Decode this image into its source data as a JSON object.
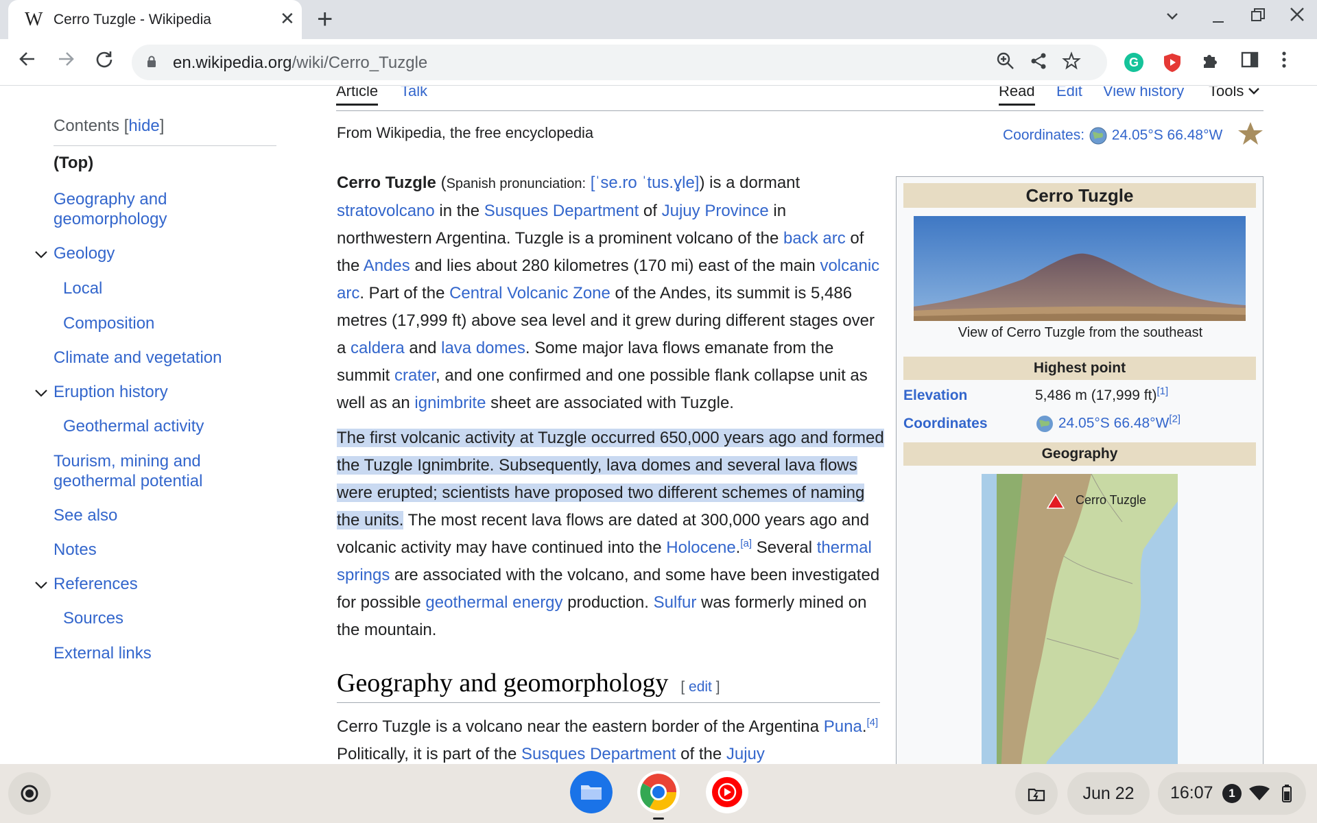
{
  "browser": {
    "tab_title": "Cerro Tuzgle - Wikipedia",
    "favicon": "W",
    "url_host": "en.wikipedia.org",
    "url_path": "/wiki/Cerro_Tuzgle"
  },
  "wiki": {
    "tabs": {
      "article": "Article",
      "talk": "Talk",
      "read": "Read",
      "edit": "Edit",
      "history": "View history",
      "tools": "Tools"
    },
    "from": "From Wikipedia, the free encyclopedia",
    "coords_label": "Coordinates:",
    "coords_value": "24.05°S 66.48°W"
  },
  "toc": {
    "heading": "Contents",
    "hide": "hide",
    "items": [
      "(Top)",
      "Geography and",
      "geomorphology",
      "Geology",
      "Local",
      "Composition",
      "Climate and vegetation",
      "Eruption history",
      "Geothermal activity",
      "Tourism, mining and",
      "geothermal potential",
      "See also",
      "Notes",
      "References",
      "Sources",
      "External links"
    ]
  },
  "article": {
    "title_bold": "Cerro Tuzgle",
    "p1": {
      "spanish": "Spanish pronunciation:",
      "ipa": "[ˈse.ro ˈtus.ɣle]",
      "t1": ") is a dormant",
      "l_strato": "stratovolcano",
      "t2": " in the ",
      "l_susques": "Susques Department",
      "t3": " of ",
      "l_jujuy": "Jujuy Province",
      "t4": " in northwestern Argentina. Tuzgle is a prominent volcano of the ",
      "l_backarc": "back arc",
      "t5": " of the ",
      "l_andes": "Andes",
      "t6": " and lies about 280 kilometres (170 mi) east of the main ",
      "l_volcarc": "volcanic arc",
      "t7": ". Part of the ",
      "l_cvz": "Central Volcanic Zone",
      "t8": " of the Andes, its summit is 5,486 metres (17,999 ft) above sea level and it grew during different stages over a ",
      "l_caldera": "caldera",
      "t9": " and ",
      "l_domes": "lava domes",
      "t10": ". Some major lava flows emanate from the summit ",
      "l_crater": "crater",
      "t11": ", and one confirmed and one possible flank collapse unit as well as an ",
      "l_ign": "ignimbrite",
      "t12": " sheet are associated with Tuzgle."
    },
    "p2": {
      "highlighted": "The first volcanic activity at Tuzgle occurred 650,000 years ago and formed the Tuzgle Ignimbrite. Subsequently, lava domes and several lava flows were erupted; scientists have proposed two different schemes of naming the units.",
      "t1": " The most recent lava flows are dated at 300,000 years ago and volcanic activity may have continued into the ",
      "l_holocene": "Holocene",
      "t2": ".",
      "note_a": "[a]",
      "t3": " Several ",
      "l_thermal": "thermal springs",
      "t4": " are associated with the volcano, and some have been investigated for possible ",
      "l_geo": "geothermal energy",
      "t5": " production. ",
      "l_sulfur": "Sulfur",
      "t6": " was formerly mined on the mountain."
    },
    "h2": "Geography and geomorphology",
    "h2_edit": "edit",
    "p3": {
      "t1": "Cerro Tuzgle is a volcano near the eastern border of the Argentina ",
      "l_puna": "Puna",
      "t2": ".",
      "ref4": "[4]",
      "t3": " Politically, it is part of the ",
      "l_susques": "Susques Department",
      "t4": " of the ",
      "l_jujuy": "Jujuy"
    }
  },
  "infobox": {
    "title": "Cerro Tuzgle",
    "caption": "View of Cerro Tuzgle from the southeast",
    "highest_point": "Highest point",
    "elevation_label": "Elevation",
    "elevation_value": "5,486 m (17,999 ft)",
    "elevation_ref": "[1]",
    "coords_label": "Coordinates",
    "coords_value": "24.05°S 66.48°W",
    "coords_ref": "[2]",
    "geography": "Geography",
    "map_label": "Cerro Tuzgle"
  },
  "shelf": {
    "date": "Jun 22",
    "time": "16:07",
    "notifications": "1"
  },
  "colors": {
    "link": "#3366cc",
    "highlight": "#c9d9f1",
    "infobox_header": "#e7dcc3"
  }
}
